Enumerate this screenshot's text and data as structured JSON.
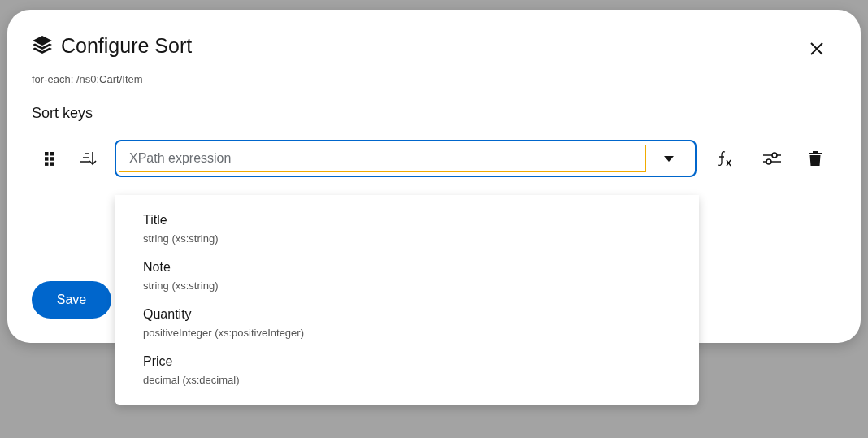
{
  "modal": {
    "title": "Configure Sort",
    "subtitle": "for-each: /ns0:Cart/Item",
    "section_title": "Sort keys",
    "sort_key": {
      "placeholder": "XPath expression",
      "expanded": true
    },
    "suggestions": [
      {
        "name": "Title",
        "type": "string (xs:string)"
      },
      {
        "name": "Note",
        "type": "string (xs:string)"
      },
      {
        "name": "Quantity",
        "type": "positiveInteger (xs:positiveInteger)"
      },
      {
        "name": "Price",
        "type": "decimal (xs:decimal)"
      }
    ],
    "save_button": "Save"
  }
}
